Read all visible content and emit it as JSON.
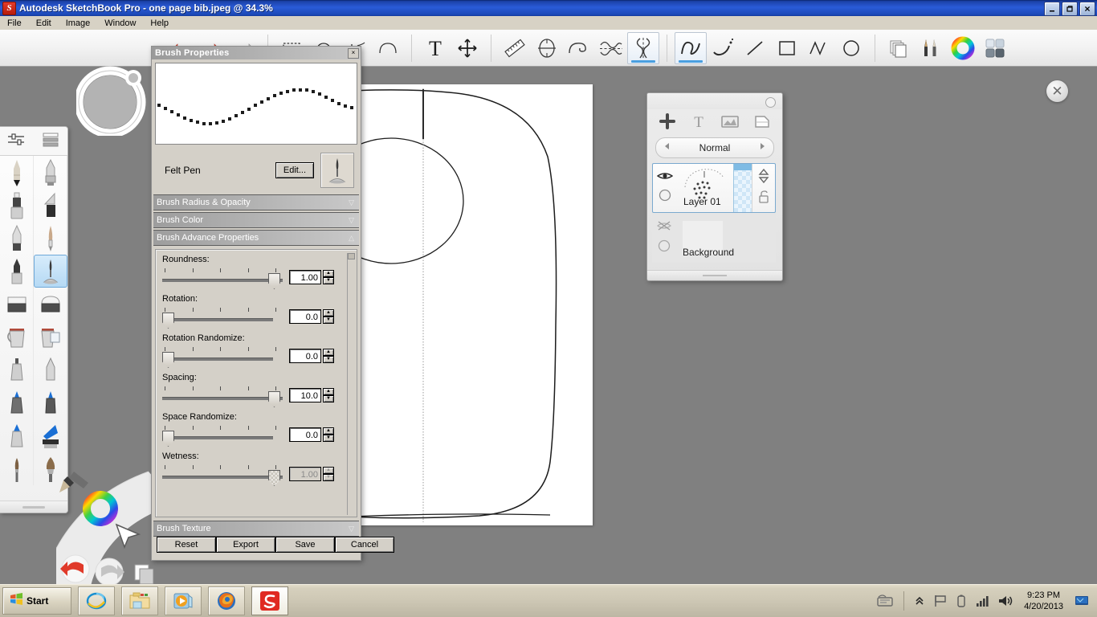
{
  "window": {
    "title": "Autodesk SketchBook Pro - one page bib.jpeg @ 34.3%",
    "app_icon": "sketchbook-s-icon",
    "minimize_label": "_",
    "restore_label": "❐",
    "close_label": "✕"
  },
  "menu": {
    "items": [
      {
        "label": "File"
      },
      {
        "label": "Edit"
      },
      {
        "label": "Image"
      },
      {
        "label": "Window"
      },
      {
        "label": "Help"
      }
    ]
  },
  "toolbar": {
    "groups": [
      {
        "name": "history",
        "tools": [
          {
            "icon": "undo-icon",
            "label": "Undo",
            "selected": false
          },
          {
            "icon": "redo-icon",
            "label": "Redo",
            "selected": false
          },
          {
            "icon": "redo-arrow-icon",
            "label": "Redo Arrow",
            "selected": false
          }
        ]
      },
      {
        "name": "selection",
        "tools": [
          {
            "icon": "rectangle-select-icon",
            "label": "Rectangle Select",
            "selected": false
          },
          {
            "icon": "lasso-select-icon",
            "label": "Lasso Select",
            "selected": false
          },
          {
            "icon": "magic-wand-icon",
            "label": "Magic Wand",
            "selected": false
          },
          {
            "icon": "ellipse-select-icon",
            "label": "Ellipse Select",
            "selected": false
          }
        ]
      },
      {
        "name": "text-transform",
        "tools": [
          {
            "icon": "text-tool-icon",
            "label": "Text",
            "selected": false
          },
          {
            "icon": "move-tool-icon",
            "label": "Move",
            "selected": false
          }
        ]
      },
      {
        "name": "guides",
        "tools": [
          {
            "icon": "ruler-icon",
            "label": "Ruler",
            "selected": false
          },
          {
            "icon": "ellipse-guide-icon",
            "label": "Ellipse Guide",
            "selected": false
          },
          {
            "icon": "french-curve-icon",
            "label": "French Curve",
            "selected": false
          },
          {
            "icon": "symmetry-x-icon",
            "label": "Symmetry X",
            "selected": false
          },
          {
            "icon": "symmetry-y-icon",
            "label": "Symmetry Y",
            "selected": true
          }
        ]
      },
      {
        "name": "strokes",
        "tools": [
          {
            "icon": "freeform-stroke-icon",
            "label": "Freeform",
            "selected": true
          },
          {
            "icon": "dotted-stroke-icon",
            "label": "Dotted Stroke",
            "selected": false
          },
          {
            "icon": "straight-line-icon",
            "label": "Straight Line",
            "selected": false
          },
          {
            "icon": "rectangle-shape-icon",
            "label": "Rectangle",
            "selected": false
          },
          {
            "icon": "polyline-icon",
            "label": "Polyline",
            "selected": false
          },
          {
            "icon": "ellipse-shape-icon",
            "label": "Ellipse",
            "selected": false
          }
        ]
      },
      {
        "name": "panels",
        "tools": [
          {
            "icon": "layers-icon",
            "label": "Layers",
            "selected": false
          },
          {
            "icon": "brush-palette-icon",
            "label": "Brush Palette",
            "selected": false
          },
          {
            "icon": "color-wheel-icon",
            "label": "Color Wheel",
            "selected": false
          },
          {
            "icon": "swatches-icon",
            "label": "Swatches",
            "selected": false
          }
        ]
      }
    ]
  },
  "brush_palette": {
    "header_icons": [
      {
        "icon": "sliders-icon",
        "label": "Brush Properties"
      },
      {
        "icon": "list-view-icon",
        "label": "List View"
      }
    ],
    "brushes": [
      {
        "icon": "pencil-icon",
        "label": "Pencil",
        "selected": false
      },
      {
        "icon": "airbrush-icon",
        "label": "Airbrush",
        "selected": false
      },
      {
        "icon": "marker-icon",
        "label": "Marker",
        "selected": false
      },
      {
        "icon": "chisel-marker-icon",
        "label": "Chisel Marker",
        "selected": false
      },
      {
        "icon": "ballpoint-pen-icon",
        "label": "Ballpoint Pen",
        "selected": false
      },
      {
        "icon": "nib-pen-icon",
        "label": "Nib Pen",
        "selected": false
      },
      {
        "icon": "felt-tip-icon",
        "label": "Felt Tip",
        "selected": false
      },
      {
        "icon": "felt-pen-icon",
        "label": "Felt Pen",
        "selected": true
      },
      {
        "icon": "eraser-hard-icon",
        "label": "Hard Eraser",
        "selected": false
      },
      {
        "icon": "eraser-soft-icon",
        "label": "Soft Eraser",
        "selected": false
      },
      {
        "icon": "paint-bucket-icon",
        "label": "Paint Bucket",
        "selected": false
      },
      {
        "icon": "paint-bucket-layer-icon",
        "label": "Fill Layer",
        "selected": false
      },
      {
        "icon": "paint-tube-icon",
        "label": "Paint Tube",
        "selected": false
      },
      {
        "icon": "paint-tube-wide-icon",
        "label": "Wide Tube",
        "selected": false
      },
      {
        "icon": "blue-marker-icon",
        "label": "Blue Marker",
        "selected": false
      },
      {
        "icon": "blue-marker-2-icon",
        "label": "Blue Marker 2",
        "selected": false
      },
      {
        "icon": "blue-tube-icon",
        "label": "Blue Tube",
        "selected": false
      },
      {
        "icon": "blue-flat-brush-icon",
        "label": "Blue Flat Brush",
        "selected": false
      },
      {
        "icon": "round-brush-icon",
        "label": "Round Brush",
        "selected": false
      },
      {
        "icon": "fan-brush-icon",
        "label": "Fan Brush",
        "selected": false
      }
    ]
  },
  "brush_properties": {
    "title": "Brush Properties",
    "close_label": "×",
    "preview_name": "preview-stroke",
    "brush_name": "Felt Pen",
    "edit_label": "Edit...",
    "swatch_icon": "felt-pen-icon",
    "sections": [
      {
        "label": "Brush Radius & Opacity",
        "expanded": false,
        "chevron": "▽"
      },
      {
        "label": "Brush Color",
        "expanded": false,
        "chevron": "▽"
      },
      {
        "label": "Brush Advance Properties",
        "expanded": true,
        "chevron": "△"
      }
    ],
    "texture_section": {
      "label": "Brush Texture",
      "expanded": false,
      "chevron": "▽"
    },
    "sliders": [
      {
        "label": "Roundness:",
        "value": "1.00",
        "percent": 95,
        "disabled": false
      },
      {
        "label": "Rotation:",
        "value": "0.0",
        "percent": 2,
        "disabled": false
      },
      {
        "label": "Rotation Randomize:",
        "value": "0.0",
        "percent": 2,
        "disabled": false
      },
      {
        "label": "Spacing:",
        "value": "10.0",
        "percent": 95,
        "disabled": false
      },
      {
        "label": "Space Randomize:",
        "value": "0.0",
        "percent": 2,
        "disabled": false
      },
      {
        "label": "Wetness:",
        "value": "1.00",
        "percent": 95,
        "disabled": true
      }
    ],
    "spinner_up": "▲",
    "spinner_down": "▼",
    "buttons": [
      {
        "label": "Reset"
      },
      {
        "label": "Export"
      },
      {
        "label": "Save"
      },
      {
        "label": "Cancel"
      }
    ]
  },
  "layers_panel": {
    "collapse_icon": "collapse-dot-icon",
    "tool_icons": [
      {
        "icon": "add-layer-icon",
        "label": "Add Layer"
      },
      {
        "icon": "add-text-layer-icon",
        "label": "Add Text"
      },
      {
        "icon": "add-image-layer-icon",
        "label": "Add Image"
      },
      {
        "icon": "duplicate-layer-icon",
        "label": "Duplicate Layer"
      }
    ],
    "blend_mode": {
      "prev_icon": "chevron-left-icon",
      "value": "Normal",
      "next_icon": "chevron-right-icon"
    },
    "layers": [
      {
        "name": "Layer 01",
        "visible": true,
        "visibility_icon": "eye-icon",
        "opacity_icon": "opacity-circle-icon",
        "selected": true,
        "move_icon": "move-updown-icon",
        "lock_icon": "unlock-icon"
      },
      {
        "name": "Background",
        "visible": false,
        "visibility_icon": "eye-off-icon",
        "opacity_icon": "opacity-circle-icon",
        "selected": false,
        "move_icon": "",
        "lock_icon": ""
      }
    ]
  },
  "canvas": {
    "name": "bib-pattern-drawing",
    "zoom": "34.3%"
  },
  "overlay": {
    "puck_icon": "puck-ring-icon",
    "close_icon": "close-circle-icon",
    "close_label": "✕",
    "lagoon": {
      "brush_icon": "lagoon-brush-icon",
      "color_icon": "lagoon-color-wheel-icon",
      "cursor_icon": "lagoon-cursor-icon",
      "undo_icon": "lagoon-undo-icon",
      "redo_icon": "lagoon-redo-icon",
      "layers_icon": "lagoon-layers-icon"
    }
  },
  "taskbar": {
    "start_label": "Start",
    "start_icon": "windows-flag-icon",
    "items": [
      {
        "icon": "internet-explorer-icon",
        "label": "Internet Explorer",
        "active": false
      },
      {
        "icon": "file-explorer-icon",
        "label": "File Explorer",
        "active": false
      },
      {
        "icon": "media-player-icon",
        "label": "Windows Media Player",
        "active": false
      },
      {
        "icon": "firefox-icon",
        "label": "Mozilla Firefox",
        "active": false
      },
      {
        "icon": "sketchbook-icon",
        "label": "Autodesk SketchBook Pro",
        "active": true
      }
    ],
    "tray": {
      "handwriting_icon": "handwriting-panel-icon",
      "expand_icon": "show-hidden-icons-icon",
      "flag_icon": "action-center-flag-icon",
      "battery_icon": "battery-icon",
      "network_icon": "network-signal-icon",
      "volume_icon": "volume-icon",
      "time": "9:23 PM",
      "date": "4/20/2013",
      "show_desktop_icon": "show-desktop-icon"
    }
  }
}
